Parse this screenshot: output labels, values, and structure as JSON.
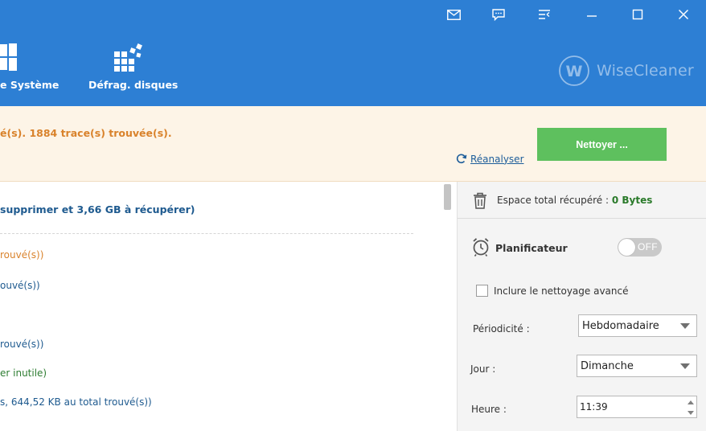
{
  "toolbar": {
    "nav": [
      {
        "label": "e Système",
        "icon": "windows-icon"
      },
      {
        "label": "Défrag. disques",
        "icon": "defrag-icon"
      }
    ],
    "brand": "WiseCleaner",
    "window_controls": [
      "mail-icon",
      "feedback-icon",
      "menu-icon",
      "minimize-icon",
      "maximize-icon",
      "close-icon"
    ]
  },
  "banner": {
    "summary": "é(s). 1884 trace(s) trouvée(s).",
    "clean_label": "Nettoyer ...",
    "rescan_label": "Réanalyser"
  },
  "results": {
    "header": "supprimer et 3,66 GB à récupérer)",
    "rows": [
      {
        "text": "rouvé(s))",
        "color": "#d9822b"
      },
      {
        "text": "ouvé(s))",
        "color": "#1e5a8f"
      },
      {
        "text": "rouvé(s))",
        "color": "#1e5a8f"
      },
      {
        "text": "er inutile)",
        "color": "#2e7d32"
      },
      {
        "text": "s, 644,52 KB au total trouvé(s))",
        "color": "#1e5a8f"
      }
    ]
  },
  "panel": {
    "space_label": "Espace total récupéré :",
    "space_value": "0 Bytes",
    "scheduler_label": "Planificateur",
    "toggle_state": "OFF",
    "advanced_label": "Inclure le nettoyage avancé",
    "frequency_label": "Périodicité :",
    "frequency_value": "Hebdomadaire",
    "day_label": "Jour :",
    "day_value": "Dimanche",
    "time_label": "Heure :",
    "time_value": "11:39"
  },
  "colors": {
    "header_bg": "#2d7fd4",
    "clean_button": "#5ec05e",
    "banner_bg": "#fdf4e7",
    "summary_text": "#d9822b"
  }
}
